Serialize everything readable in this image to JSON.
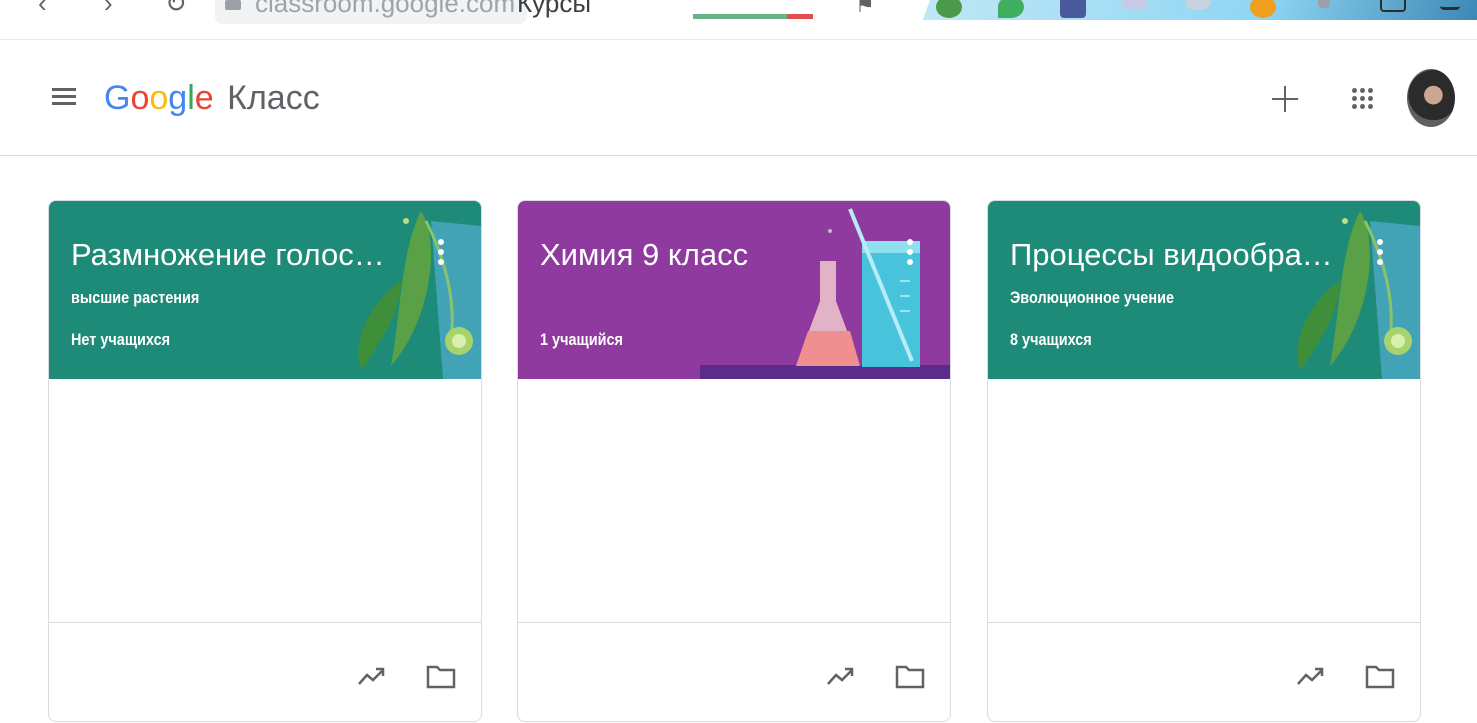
{
  "browser": {
    "url": "classroom.google.com",
    "tab_title": "Курсы",
    "colors": {
      "progress": "#6ab187",
      "progress_end": "#e05050"
    }
  },
  "header": {
    "logo_letters": [
      "G",
      "o",
      "o",
      "g",
      "l",
      "e"
    ],
    "product_name": "Класс",
    "icons": [
      "menu-icon",
      "plus-icon",
      "apps-icon",
      "avatar"
    ]
  },
  "courses": [
    {
      "title": "Размножение голосеменных",
      "subtitle": "высшие растения",
      "students": "Нет учащихся",
      "color": "#1e8a78",
      "illustration": "plant-illustration"
    },
    {
      "title": "Химия 9 класс",
      "subtitle": "",
      "students": "1 учащийся",
      "color": "#8e3a9e",
      "illustration": "chemistry-illustration"
    },
    {
      "title": "Процессы видообразования",
      "subtitle": "Эволюционное учение",
      "students": "8 учащихся",
      "color": "#1e8a78",
      "illustration": "plant-illustration"
    }
  ]
}
